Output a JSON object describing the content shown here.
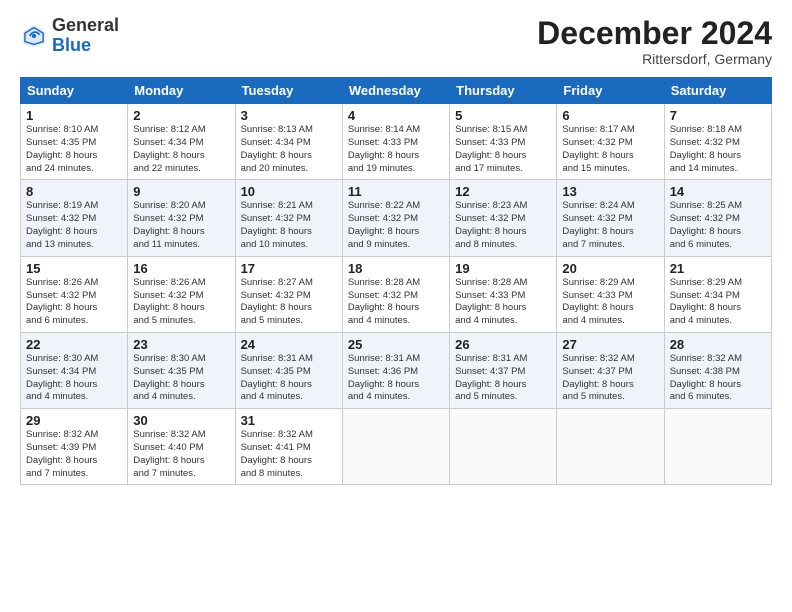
{
  "header": {
    "logo_general": "General",
    "logo_blue": "Blue",
    "month_title": "December 2024",
    "location": "Rittersdorf, Germany"
  },
  "columns": [
    "Sunday",
    "Monday",
    "Tuesday",
    "Wednesday",
    "Thursday",
    "Friday",
    "Saturday"
  ],
  "weeks": [
    [
      {
        "day": "1",
        "info": "Sunrise: 8:10 AM\nSunset: 4:35 PM\nDaylight: 8 hours\nand 24 minutes."
      },
      {
        "day": "2",
        "info": "Sunrise: 8:12 AM\nSunset: 4:34 PM\nDaylight: 8 hours\nand 22 minutes."
      },
      {
        "day": "3",
        "info": "Sunrise: 8:13 AM\nSunset: 4:34 PM\nDaylight: 8 hours\nand 20 minutes."
      },
      {
        "day": "4",
        "info": "Sunrise: 8:14 AM\nSunset: 4:33 PM\nDaylight: 8 hours\nand 19 minutes."
      },
      {
        "day": "5",
        "info": "Sunrise: 8:15 AM\nSunset: 4:33 PM\nDaylight: 8 hours\nand 17 minutes."
      },
      {
        "day": "6",
        "info": "Sunrise: 8:17 AM\nSunset: 4:32 PM\nDaylight: 8 hours\nand 15 minutes."
      },
      {
        "day": "7",
        "info": "Sunrise: 8:18 AM\nSunset: 4:32 PM\nDaylight: 8 hours\nand 14 minutes."
      }
    ],
    [
      {
        "day": "8",
        "info": "Sunrise: 8:19 AM\nSunset: 4:32 PM\nDaylight: 8 hours\nand 13 minutes."
      },
      {
        "day": "9",
        "info": "Sunrise: 8:20 AM\nSunset: 4:32 PM\nDaylight: 8 hours\nand 11 minutes."
      },
      {
        "day": "10",
        "info": "Sunrise: 8:21 AM\nSunset: 4:32 PM\nDaylight: 8 hours\nand 10 minutes."
      },
      {
        "day": "11",
        "info": "Sunrise: 8:22 AM\nSunset: 4:32 PM\nDaylight: 8 hours\nand 9 minutes."
      },
      {
        "day": "12",
        "info": "Sunrise: 8:23 AM\nSunset: 4:32 PM\nDaylight: 8 hours\nand 8 minutes."
      },
      {
        "day": "13",
        "info": "Sunrise: 8:24 AM\nSunset: 4:32 PM\nDaylight: 8 hours\nand 7 minutes."
      },
      {
        "day": "14",
        "info": "Sunrise: 8:25 AM\nSunset: 4:32 PM\nDaylight: 8 hours\nand 6 minutes."
      }
    ],
    [
      {
        "day": "15",
        "info": "Sunrise: 8:26 AM\nSunset: 4:32 PM\nDaylight: 8 hours\nand 6 minutes."
      },
      {
        "day": "16",
        "info": "Sunrise: 8:26 AM\nSunset: 4:32 PM\nDaylight: 8 hours\nand 5 minutes."
      },
      {
        "day": "17",
        "info": "Sunrise: 8:27 AM\nSunset: 4:32 PM\nDaylight: 8 hours\nand 5 minutes."
      },
      {
        "day": "18",
        "info": "Sunrise: 8:28 AM\nSunset: 4:32 PM\nDaylight: 8 hours\nand 4 minutes."
      },
      {
        "day": "19",
        "info": "Sunrise: 8:28 AM\nSunset: 4:33 PM\nDaylight: 8 hours\nand 4 minutes."
      },
      {
        "day": "20",
        "info": "Sunrise: 8:29 AM\nSunset: 4:33 PM\nDaylight: 8 hours\nand 4 minutes."
      },
      {
        "day": "21",
        "info": "Sunrise: 8:29 AM\nSunset: 4:34 PM\nDaylight: 8 hours\nand 4 minutes."
      }
    ],
    [
      {
        "day": "22",
        "info": "Sunrise: 8:30 AM\nSunset: 4:34 PM\nDaylight: 8 hours\nand 4 minutes."
      },
      {
        "day": "23",
        "info": "Sunrise: 8:30 AM\nSunset: 4:35 PM\nDaylight: 8 hours\nand 4 minutes."
      },
      {
        "day": "24",
        "info": "Sunrise: 8:31 AM\nSunset: 4:35 PM\nDaylight: 8 hours\nand 4 minutes."
      },
      {
        "day": "25",
        "info": "Sunrise: 8:31 AM\nSunset: 4:36 PM\nDaylight: 8 hours\nand 4 minutes."
      },
      {
        "day": "26",
        "info": "Sunrise: 8:31 AM\nSunset: 4:37 PM\nDaylight: 8 hours\nand 5 minutes."
      },
      {
        "day": "27",
        "info": "Sunrise: 8:32 AM\nSunset: 4:37 PM\nDaylight: 8 hours\nand 5 minutes."
      },
      {
        "day": "28",
        "info": "Sunrise: 8:32 AM\nSunset: 4:38 PM\nDaylight: 8 hours\nand 6 minutes."
      }
    ],
    [
      {
        "day": "29",
        "info": "Sunrise: 8:32 AM\nSunset: 4:39 PM\nDaylight: 8 hours\nand 7 minutes."
      },
      {
        "day": "30",
        "info": "Sunrise: 8:32 AM\nSunset: 4:40 PM\nDaylight: 8 hours\nand 7 minutes."
      },
      {
        "day": "31",
        "info": "Sunrise: 8:32 AM\nSunset: 4:41 PM\nDaylight: 8 hours\nand 8 minutes."
      },
      {
        "day": "",
        "info": ""
      },
      {
        "day": "",
        "info": ""
      },
      {
        "day": "",
        "info": ""
      },
      {
        "day": "",
        "info": ""
      }
    ]
  ]
}
